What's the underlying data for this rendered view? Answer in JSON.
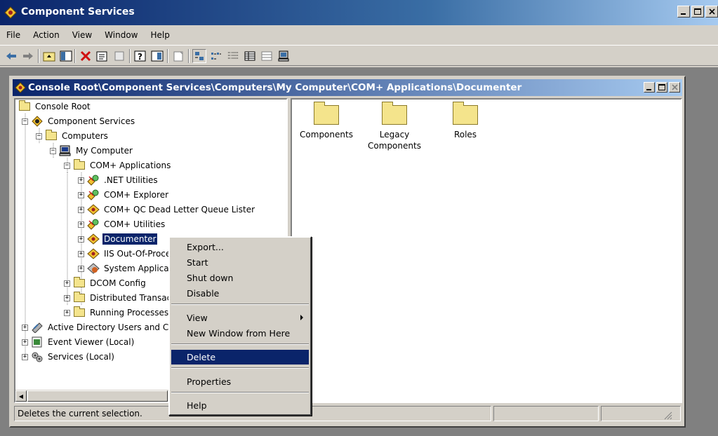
{
  "window": {
    "title": "Component Services"
  },
  "menu": [
    "File",
    "Action",
    "View",
    "Window",
    "Help"
  ],
  "toolbar_icons": [
    "back-arrow-icon",
    "forward-arrow-icon",
    "up-folder-icon",
    "show-hide-tree-icon",
    "delete-icon",
    "properties-icon",
    "refresh-icon",
    "help-icon",
    "details-icon",
    "new-window-icon",
    "large-icons-view-icon",
    "small-icons-view-icon",
    "list-view-icon",
    "detail-view-icon",
    "status-view-icon",
    "computer-view-icon"
  ],
  "child_window": {
    "title": "Console Root\\Component Services\\Computers\\My Computer\\COM+ Applications\\Documenter"
  },
  "tree": [
    {
      "label": "Console Root",
      "icon": "folder-icon"
    },
    {
      "label": "Component Services",
      "icon": "component-services-icon"
    },
    {
      "label": "Computers",
      "icon": "folder-icon"
    },
    {
      "label": "My Computer",
      "icon": "computer-icon"
    },
    {
      "label": "COM+ Applications",
      "icon": "folder-icon"
    },
    {
      "label": ".NET Utilities",
      "icon": "com-app-icon"
    },
    {
      "label": "COM+ Explorer",
      "icon": "com-app-icon"
    },
    {
      "label": "COM+ QC Dead Letter Queue Lister",
      "icon": "com-app-icon"
    },
    {
      "label": "COM+ Utilities",
      "icon": "com-app-icon"
    },
    {
      "label": "Documenter",
      "icon": "com-app-icon",
      "selected": true
    },
    {
      "label": "IIS Out-Of-Process Pooled Applications",
      "icon": "com-app-icon"
    },
    {
      "label": "System Application",
      "icon": "system-app-icon"
    },
    {
      "label": "DCOM Config",
      "icon": "folder-icon"
    },
    {
      "label": "Distributed Transaction Coordinator",
      "icon": "folder-icon"
    },
    {
      "label": "Running Processes",
      "icon": "folder-icon"
    },
    {
      "label": "Active Directory Users and Computers",
      "icon": "ad-users-icon"
    },
    {
      "label": "Event Viewer (Local)",
      "icon": "event-viewer-icon"
    },
    {
      "label": "Services (Local)",
      "icon": "services-icon"
    }
  ],
  "list_items": [
    {
      "label": "Components"
    },
    {
      "label": "Legacy\nComponents"
    },
    {
      "label": "Roles"
    }
  ],
  "context_menu": {
    "export": "Export...",
    "start": "Start",
    "shut_down": "Shut down",
    "disable": "Disable",
    "view": "View",
    "new_window": "New Window from Here",
    "delete": "Delete",
    "properties": "Properties",
    "help": "Help"
  },
  "status": {
    "text": "Deletes the current selection."
  }
}
